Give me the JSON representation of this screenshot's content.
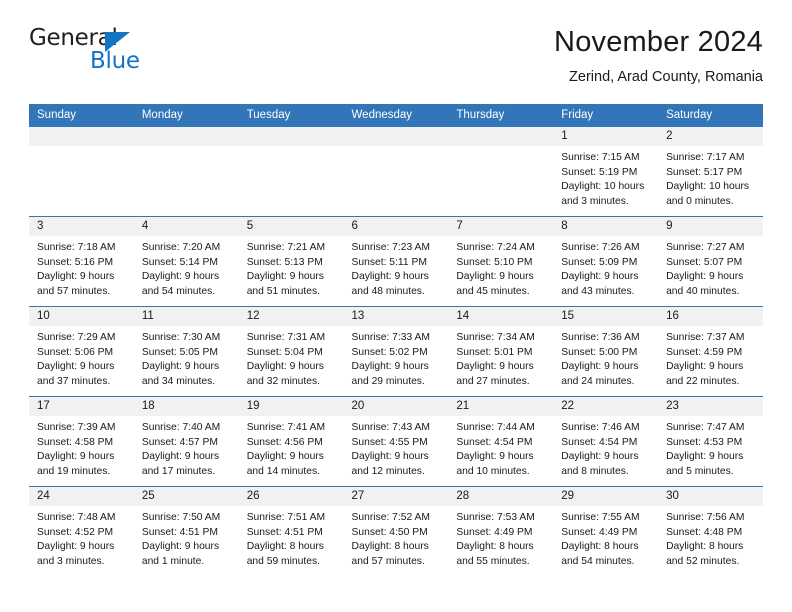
{
  "logo": {
    "word_top": "General",
    "word_bottom": "Blue",
    "accent_color": "#1474c4"
  },
  "header": {
    "title": "November 2024",
    "subtitle": "Zerind, Arad County, Romania"
  },
  "theme": {
    "header_blue": "#3275b8",
    "band_gray": "#f1f1f1",
    "text": "#1a1a1a"
  },
  "calendar": {
    "weekday_headers": [
      "Sunday",
      "Monday",
      "Tuesday",
      "Wednesday",
      "Thursday",
      "Friday",
      "Saturday"
    ],
    "labels": {
      "sunrise": "Sunrise:",
      "sunset": "Sunset:",
      "daylight": "Daylight:"
    },
    "weeks": [
      [
        {
          "day": "",
          "empty": true
        },
        {
          "day": "",
          "empty": true
        },
        {
          "day": "",
          "empty": true
        },
        {
          "day": "",
          "empty": true
        },
        {
          "day": "",
          "empty": true
        },
        {
          "day": "1",
          "sunrise": "Sunrise: 7:15 AM",
          "sunset": "Sunset: 5:19 PM",
          "daylight": "Daylight: 10 hours and 3 minutes."
        },
        {
          "day": "2",
          "sunrise": "Sunrise: 7:17 AM",
          "sunset": "Sunset: 5:17 PM",
          "daylight": "Daylight: 10 hours and 0 minutes."
        }
      ],
      [
        {
          "day": "3",
          "sunrise": "Sunrise: 7:18 AM",
          "sunset": "Sunset: 5:16 PM",
          "daylight": "Daylight: 9 hours and 57 minutes."
        },
        {
          "day": "4",
          "sunrise": "Sunrise: 7:20 AM",
          "sunset": "Sunset: 5:14 PM",
          "daylight": "Daylight: 9 hours and 54 minutes."
        },
        {
          "day": "5",
          "sunrise": "Sunrise: 7:21 AM",
          "sunset": "Sunset: 5:13 PM",
          "daylight": "Daylight: 9 hours and 51 minutes."
        },
        {
          "day": "6",
          "sunrise": "Sunrise: 7:23 AM",
          "sunset": "Sunset: 5:11 PM",
          "daylight": "Daylight: 9 hours and 48 minutes."
        },
        {
          "day": "7",
          "sunrise": "Sunrise: 7:24 AM",
          "sunset": "Sunset: 5:10 PM",
          "daylight": "Daylight: 9 hours and 45 minutes."
        },
        {
          "day": "8",
          "sunrise": "Sunrise: 7:26 AM",
          "sunset": "Sunset: 5:09 PM",
          "daylight": "Daylight: 9 hours and 43 minutes."
        },
        {
          "day": "9",
          "sunrise": "Sunrise: 7:27 AM",
          "sunset": "Sunset: 5:07 PM",
          "daylight": "Daylight: 9 hours and 40 minutes."
        }
      ],
      [
        {
          "day": "10",
          "sunrise": "Sunrise: 7:29 AM",
          "sunset": "Sunset: 5:06 PM",
          "daylight": "Daylight: 9 hours and 37 minutes."
        },
        {
          "day": "11",
          "sunrise": "Sunrise: 7:30 AM",
          "sunset": "Sunset: 5:05 PM",
          "daylight": "Daylight: 9 hours and 34 minutes."
        },
        {
          "day": "12",
          "sunrise": "Sunrise: 7:31 AM",
          "sunset": "Sunset: 5:04 PM",
          "daylight": "Daylight: 9 hours and 32 minutes."
        },
        {
          "day": "13",
          "sunrise": "Sunrise: 7:33 AM",
          "sunset": "Sunset: 5:02 PM",
          "daylight": "Daylight: 9 hours and 29 minutes."
        },
        {
          "day": "14",
          "sunrise": "Sunrise: 7:34 AM",
          "sunset": "Sunset: 5:01 PM",
          "daylight": "Daylight: 9 hours and 27 minutes."
        },
        {
          "day": "15",
          "sunrise": "Sunrise: 7:36 AM",
          "sunset": "Sunset: 5:00 PM",
          "daylight": "Daylight: 9 hours and 24 minutes."
        },
        {
          "day": "16",
          "sunrise": "Sunrise: 7:37 AM",
          "sunset": "Sunset: 4:59 PM",
          "daylight": "Daylight: 9 hours and 22 minutes."
        }
      ],
      [
        {
          "day": "17",
          "sunrise": "Sunrise: 7:39 AM",
          "sunset": "Sunset: 4:58 PM",
          "daylight": "Daylight: 9 hours and 19 minutes."
        },
        {
          "day": "18",
          "sunrise": "Sunrise: 7:40 AM",
          "sunset": "Sunset: 4:57 PM",
          "daylight": "Daylight: 9 hours and 17 minutes."
        },
        {
          "day": "19",
          "sunrise": "Sunrise: 7:41 AM",
          "sunset": "Sunset: 4:56 PM",
          "daylight": "Daylight: 9 hours and 14 minutes."
        },
        {
          "day": "20",
          "sunrise": "Sunrise: 7:43 AM",
          "sunset": "Sunset: 4:55 PM",
          "daylight": "Daylight: 9 hours and 12 minutes."
        },
        {
          "day": "21",
          "sunrise": "Sunrise: 7:44 AM",
          "sunset": "Sunset: 4:54 PM",
          "daylight": "Daylight: 9 hours and 10 minutes."
        },
        {
          "day": "22",
          "sunrise": "Sunrise: 7:46 AM",
          "sunset": "Sunset: 4:54 PM",
          "daylight": "Daylight: 9 hours and 8 minutes."
        },
        {
          "day": "23",
          "sunrise": "Sunrise: 7:47 AM",
          "sunset": "Sunset: 4:53 PM",
          "daylight": "Daylight: 9 hours and 5 minutes."
        }
      ],
      [
        {
          "day": "24",
          "sunrise": "Sunrise: 7:48 AM",
          "sunset": "Sunset: 4:52 PM",
          "daylight": "Daylight: 9 hours and 3 minutes."
        },
        {
          "day": "25",
          "sunrise": "Sunrise: 7:50 AM",
          "sunset": "Sunset: 4:51 PM",
          "daylight": "Daylight: 9 hours and 1 minute."
        },
        {
          "day": "26",
          "sunrise": "Sunrise: 7:51 AM",
          "sunset": "Sunset: 4:51 PM",
          "daylight": "Daylight: 8 hours and 59 minutes."
        },
        {
          "day": "27",
          "sunrise": "Sunrise: 7:52 AM",
          "sunset": "Sunset: 4:50 PM",
          "daylight": "Daylight: 8 hours and 57 minutes."
        },
        {
          "day": "28",
          "sunrise": "Sunrise: 7:53 AM",
          "sunset": "Sunset: 4:49 PM",
          "daylight": "Daylight: 8 hours and 55 minutes."
        },
        {
          "day": "29",
          "sunrise": "Sunrise: 7:55 AM",
          "sunset": "Sunset: 4:49 PM",
          "daylight": "Daylight: 8 hours and 54 minutes."
        },
        {
          "day": "30",
          "sunrise": "Sunrise: 7:56 AM",
          "sunset": "Sunset: 4:48 PM",
          "daylight": "Daylight: 8 hours and 52 minutes."
        }
      ]
    ]
  }
}
